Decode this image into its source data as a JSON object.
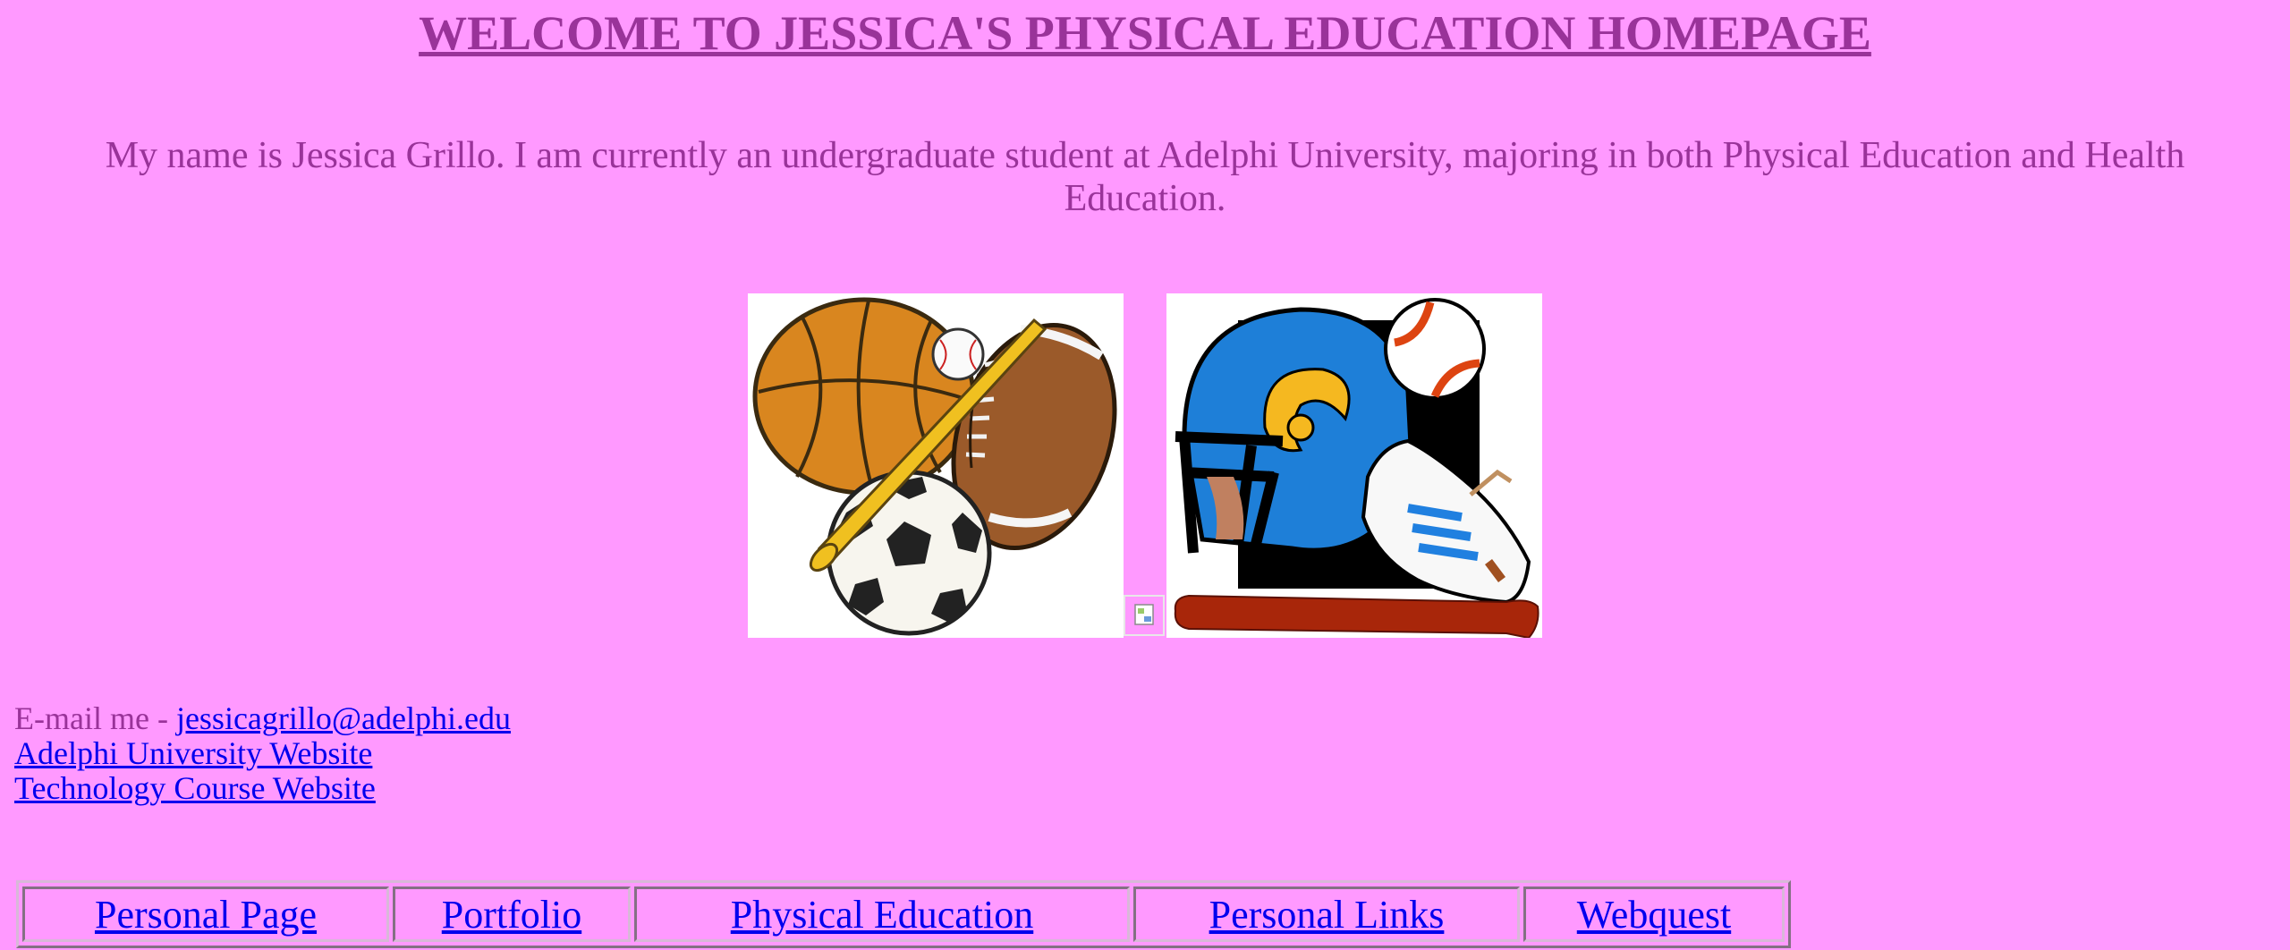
{
  "header": {
    "title": "WELCOME TO JESSICA'S PHYSICAL EDUCATION HOMEPAGE"
  },
  "intro": {
    "text": "My name is Jessica Grillo. I am currently an undergraduate student at Adelphi University, majoring in both Physical Education and Health Education."
  },
  "images": {
    "left": "sports-balls-clipart",
    "broken": "broken-image-icon",
    "right": "football-helmet-sneaker-clipart"
  },
  "contact": {
    "email_prefix": "E-mail me - ",
    "email": "jessicagrillo@adelphi.edu",
    "adelphi_link": "Adelphi University Website",
    "tech_link": "Technology Course Website"
  },
  "nav": {
    "items": [
      {
        "label": "Personal Page"
      },
      {
        "label": "Portfolio"
      },
      {
        "label": "Physical Education"
      },
      {
        "label": "Personal Links"
      },
      {
        "label": "Webquest"
      }
    ]
  },
  "colors": {
    "background": "#ff99ff",
    "text": "#993399",
    "link": "#0000ee"
  }
}
